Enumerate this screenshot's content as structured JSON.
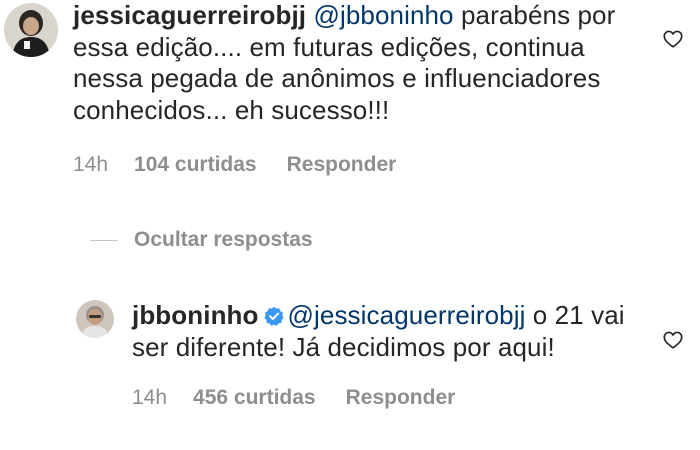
{
  "comments": [
    {
      "username": "jessicaguerreirobjj",
      "mention": "@jbboninho",
      "text": " parabéns por essa edição.... em futuras edições, continua nessa pegada de anônimos e influenciadores conhecidos... eh sucesso!!!",
      "time": "14h",
      "likes": "104 curtidas",
      "reply": "Responder"
    },
    {
      "username": "jbboninho",
      "verified": true,
      "mention": "@jessicaguerreirobjj",
      "text": " o 21 vai ser diferente! Já decidimos por aqui!",
      "time": "14h",
      "likes": "456 curtidas",
      "reply": "Responder"
    }
  ],
  "hide_replies_label": "Ocultar respostas",
  "icons": {
    "like": "heart-outline-icon",
    "verified": "verified-badge-icon"
  },
  "colors": {
    "text": "#262626",
    "muted": "#8e8e8e",
    "mention": "#00376b",
    "verified": "#3897f0"
  }
}
